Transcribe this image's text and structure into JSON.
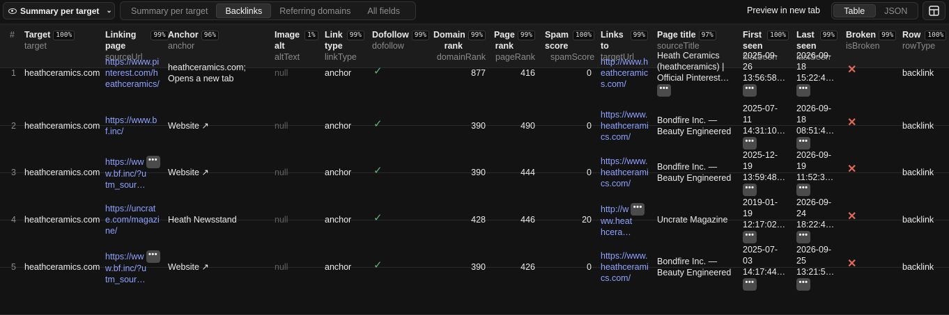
{
  "toolbar": {
    "summary_label": "Summary per target",
    "tabs": [
      "Summary per target",
      "Backlinks",
      "Referring domains",
      "All fields"
    ],
    "preview_label": "Preview in new tab",
    "view_table": "Table",
    "view_json": "JSON"
  },
  "columns": {
    "hash": "#",
    "target": {
      "label": "Target",
      "pct": "100%",
      "field": "target"
    },
    "linking": {
      "label1": "Linking",
      "label2": "page",
      "pct": "99%",
      "field": "sourceUrl"
    },
    "anchor": {
      "label": "Anchor",
      "pct": "96%",
      "field": "anchor"
    },
    "image": {
      "label1": "Image",
      "label2": "alt",
      "pct": "1%",
      "field": "altText"
    },
    "linktype": {
      "label1": "Link",
      "label2": "type",
      "pct": "99%",
      "field": "linkType"
    },
    "dofollow": {
      "label": "Dofollow",
      "pct": "99%",
      "field": "dofollow"
    },
    "domainrank": {
      "label1": "Domain",
      "label2": "rank",
      "pct": "99%",
      "field": "domainRank"
    },
    "pagerank": {
      "label1": "Page",
      "label2": "rank",
      "pct": "99%",
      "field": "pageRank"
    },
    "spam": {
      "label1": "Spam",
      "label2": "score",
      "pct": "100%",
      "field": "spamScore"
    },
    "linksto": {
      "label1": "Links",
      "label2": "to",
      "pct": "99%",
      "field": "targetUrl"
    },
    "pagetitle": {
      "label": "Page title",
      "pct": "97%",
      "field": "sourceTitle"
    },
    "firstseen": {
      "label1": "First",
      "label2": "seen",
      "pct": "100%",
      "field": "firstSeen"
    },
    "lastseen": {
      "label1": "Last",
      "label2": "seen",
      "pct": "99%",
      "field": "lastSeen"
    },
    "broken": {
      "label": "Broken",
      "pct": "99%",
      "field": "isBroken"
    },
    "rowtype": {
      "label": "Row",
      "pct": "100%",
      "field": "rowType"
    }
  },
  "rows": [
    {
      "num": "1",
      "target": "heathceramics.com",
      "link": [
        "https://www.pi",
        "nterest.com/h",
        "eathceramics/"
      ],
      "anchor": [
        "heathceramics.com;",
        "Opens a new tab"
      ],
      "alt": "null",
      "type": "anchor",
      "domain": "877",
      "page": "416",
      "spam": "0",
      "to": [
        "http://www.h",
        "eathceramic",
        "s.com/"
      ],
      "title": [
        "Heath Ceramics",
        "(heathceramics) |",
        "Official Pinterest…"
      ],
      "first": [
        "2025-09-",
        "26",
        "13:56:58…"
      ],
      "last": [
        "2026-09-",
        "18",
        "15:22:4…"
      ],
      "rowtype": "backlink"
    },
    {
      "num": "2",
      "target": "heathceramics.com",
      "link": [
        "https://www.b",
        "f.inc/"
      ],
      "anchor": [
        "Website ↗"
      ],
      "alt": "null",
      "type": "anchor",
      "domain": "390",
      "page": "490",
      "spam": "0",
      "to": [
        "https://www.",
        "heathcerami",
        "cs.com/"
      ],
      "title": [
        "Bondfire Inc. —",
        "Beauty Engineered"
      ],
      "first": [
        "2025-07-",
        "11",
        "14:31:10…"
      ],
      "last": [
        "2026-09-",
        "18",
        "08:51:4…"
      ],
      "rowtype": "backlink"
    },
    {
      "num": "3",
      "target": "heathceramics.com",
      "link": [
        "https://ww",
        "w.bf.inc/?u",
        "tm_sour…"
      ],
      "anchor": [
        "Website ↗"
      ],
      "alt": "null",
      "type": "anchor",
      "domain": "390",
      "page": "444",
      "spam": "0",
      "to": [
        "https://www.",
        "heathcerami",
        "cs.com/"
      ],
      "title": [
        "Bondfire Inc. —",
        "Beauty Engineered"
      ],
      "first": [
        "2025-12-",
        "19",
        "13:59:48…"
      ],
      "last": [
        "2026-09-",
        "19",
        "11:52:3…"
      ],
      "rowtype": "backlink"
    },
    {
      "num": "4",
      "target": "heathceramics.com",
      "link": [
        "https://uncrat",
        "e.com/magazi",
        "ne/"
      ],
      "anchor": [
        "Heath Newsstand"
      ],
      "alt": "null",
      "type": "anchor",
      "domain": "428",
      "page": "446",
      "spam": "20",
      "to": [
        "http://w",
        "ww.heat",
        "hcera…"
      ],
      "title": [
        "Uncrate Magazine"
      ],
      "first": [
        "2019-01-",
        "19",
        "12:17:02…"
      ],
      "last": [
        "2026-09-",
        "24",
        "18:22:4…"
      ],
      "rowtype": "backlink"
    },
    {
      "num": "5",
      "target": "heathceramics.com",
      "link": [
        "https://ww",
        "w.bf.inc/?u",
        "tm_sour…"
      ],
      "anchor": [
        "Website ↗"
      ],
      "alt": "null",
      "type": "anchor",
      "domain": "390",
      "page": "426",
      "spam": "0",
      "to": [
        "https://www.",
        "heathcerami",
        "cs.com/"
      ],
      "title": [
        "Bondfire Inc. —",
        "Beauty Engineered"
      ],
      "first": [
        "2025-07-",
        "03",
        "14:17:44…"
      ],
      "last": [
        "2026-09-",
        "25",
        "13:21:5…"
      ],
      "rowtype": "backlink"
    }
  ],
  "icons": {
    "dofollow": "check-icon",
    "broken": "cross-icon",
    "more": "ellipsis-icon",
    "check_glyph": "✓",
    "cross_glyph": "✕",
    "more_glyph": "•••"
  },
  "colors": {
    "background": "#131313",
    "header": "#1c1c1c",
    "link": "#8ea2ff",
    "check": "#5fb37a",
    "cross": "#e06a58"
  }
}
